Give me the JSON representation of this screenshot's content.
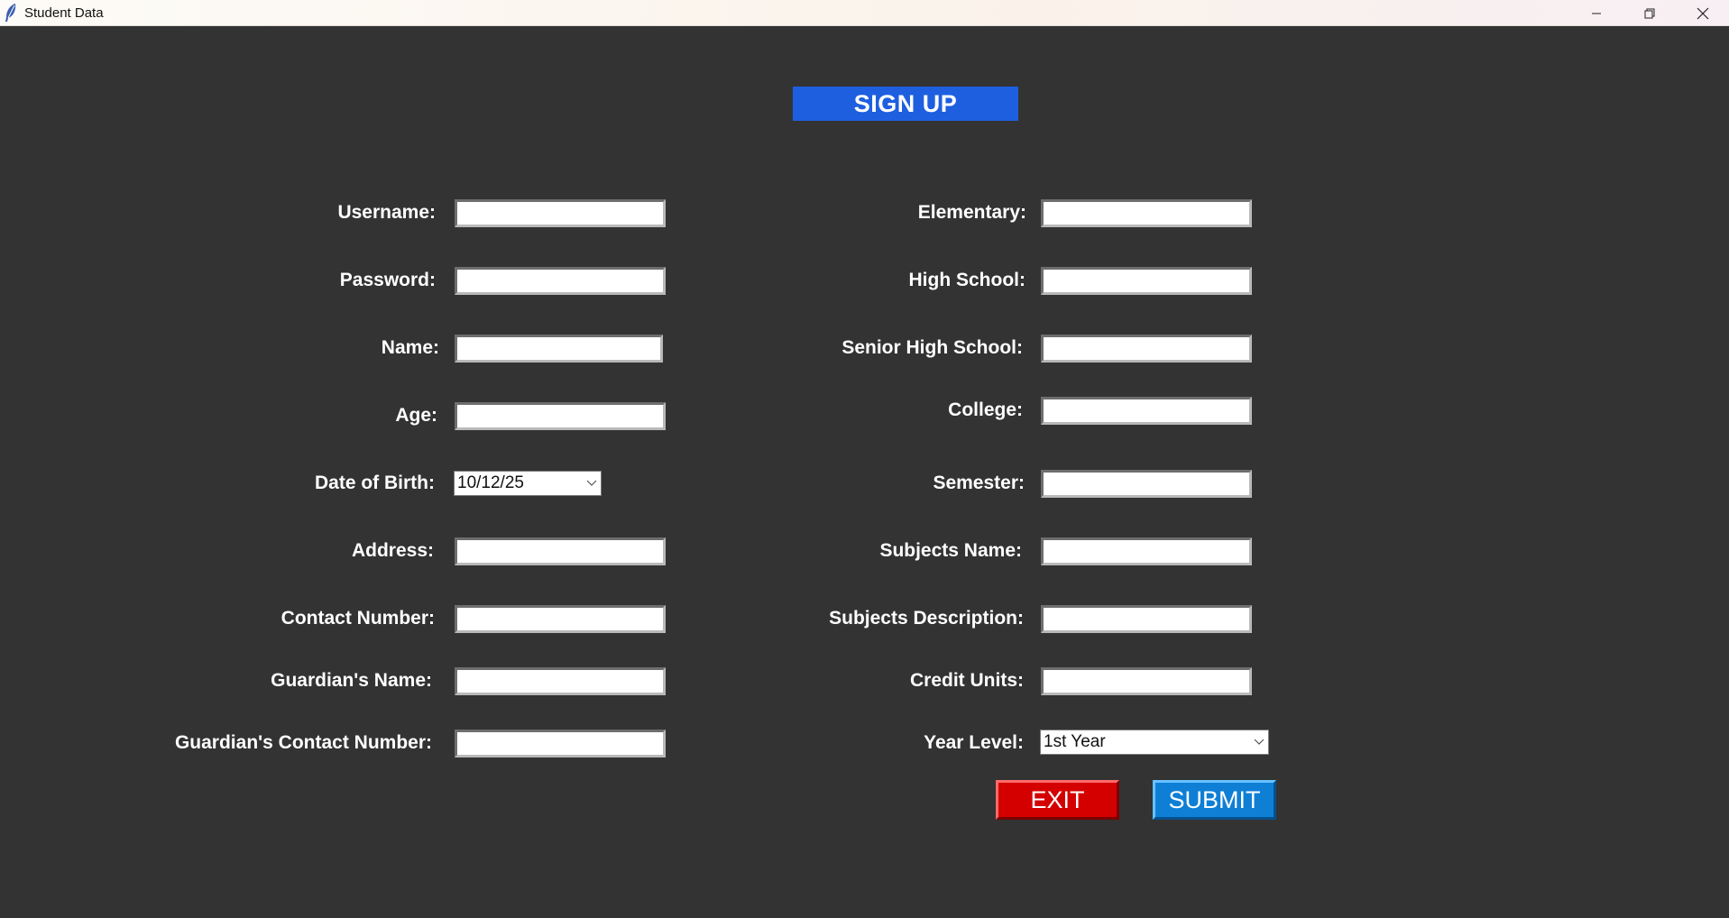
{
  "window": {
    "title": "Student Data"
  },
  "form": {
    "heading": "SIGN UP",
    "left": {
      "username_label": "Username:",
      "password_label": "Password:",
      "name_label": "Name:",
      "age_label": "Age:",
      "dob_label": "Date of Birth:",
      "dob_value": "10/12/25",
      "address_label": "Address:",
      "contact_label": "Contact Number:",
      "guardian_name_label": "Guardian's Name:",
      "guardian_contact_label": "Guardian's Contact Number:"
    },
    "right": {
      "elementary_label": "Elementary:",
      "high_school_label": "High School:",
      "senior_high_label": "Senior High School:",
      "college_label": "College:",
      "semester_label": "Semester:",
      "subjects_name_label": "Subjects Name:",
      "subjects_desc_label": "Subjects Description:",
      "credit_units_label": "Credit Units:",
      "year_level_label": "Year Level:",
      "year_level_value": "1st Year"
    },
    "fields": {
      "username": "",
      "password": "",
      "name": "",
      "age": "",
      "address": "",
      "contact": "",
      "guardian_name": "",
      "guardian_contact": "",
      "elementary": "",
      "high_school": "",
      "senior_high": "",
      "college": "",
      "semester": "",
      "subjects_name": "",
      "subjects_desc": "",
      "credit_units": ""
    },
    "buttons": {
      "exit_label": "EXIT",
      "submit_label": "SUBMIT"
    }
  },
  "colors": {
    "background": "#333333",
    "heading_bg": "#1e5fe0",
    "exit_bg": "#d40000",
    "submit_bg": "#0f7fd6"
  },
  "icons": {
    "app": "feather-icon",
    "minimize": "minimize-icon",
    "maximize": "restore-icon",
    "close": "close-icon",
    "dropdown": "chevron-down-icon"
  }
}
